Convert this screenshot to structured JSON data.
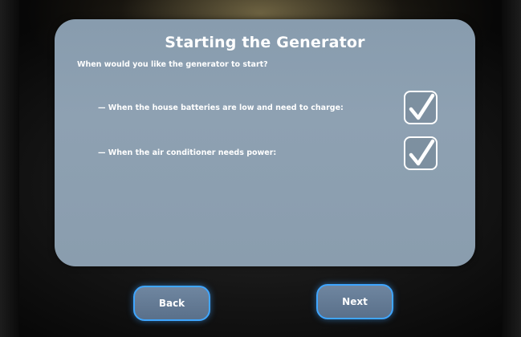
{
  "dialog": {
    "title": "Starting the Generator",
    "question": "When would you like the generator to start?",
    "options": [
      {
        "label": "— When the house batteries are low and need to charge:",
        "checked": true
      },
      {
        "label": "— When the air conditioner needs power:",
        "checked": true
      }
    ]
  },
  "navigation": {
    "back_label": "Back",
    "next_label": "Next"
  },
  "colors": {
    "panel": "#8a9dae",
    "button_fill": "#627a94",
    "button_glow": "#3fa6ff",
    "text": "#ffffff"
  }
}
